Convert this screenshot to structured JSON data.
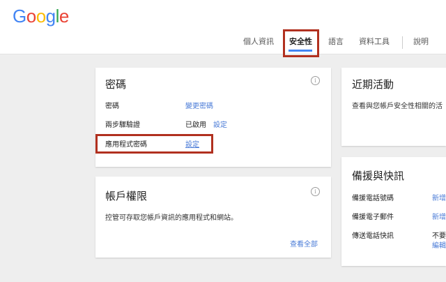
{
  "logo": {
    "letters": [
      "G",
      "o",
      "o",
      "g",
      "l",
      "e"
    ],
    "colors": [
      "#4285f4",
      "#ea4335",
      "#fbbc05",
      "#4285f4",
      "#34a853",
      "#ea4335"
    ]
  },
  "nav": {
    "tabs": [
      {
        "label": "個人資訊"
      },
      {
        "label": "安全性",
        "active": true
      },
      {
        "label": "語言"
      },
      {
        "label": "資料工具"
      },
      {
        "label": "說明"
      }
    ]
  },
  "password_card": {
    "title": "密碼",
    "rows": [
      {
        "label": "密碼",
        "link": "變更密碼"
      },
      {
        "label": "兩步驟驗證",
        "status": "已啟用",
        "link": "設定"
      },
      {
        "label": "應用程式密碼",
        "link": "設定"
      }
    ]
  },
  "permissions_card": {
    "title": "帳戶權限",
    "description": "控管可存取您帳戶資訊的應用程式和網站。",
    "view_all": "查看全部"
  },
  "recent_activity_card": {
    "title": "近期活動",
    "description": "查看與您帳戶安全性相關的活"
  },
  "recovery_card": {
    "title": "備援與快訊",
    "rows": [
      {
        "label": "備援電話號碼",
        "link": "新增"
      },
      {
        "label": "備援電子郵件",
        "link": "新增"
      },
      {
        "label": "傳送電話快訊",
        "value": "不要",
        "link": "編輯"
      }
    ]
  },
  "colors": {
    "accent": "#4285f4",
    "link": "#4a7bd7",
    "highlight": "#b1301f"
  }
}
